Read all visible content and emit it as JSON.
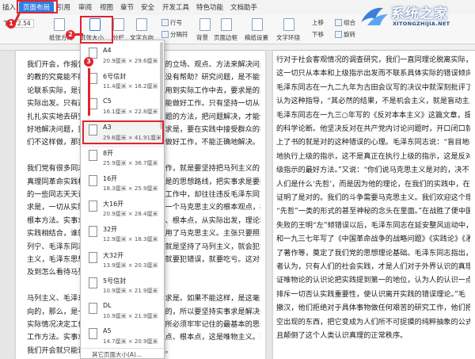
{
  "ribbon": {
    "tabs": [
      "插入",
      "页面布局",
      "引用",
      "审阅",
      "视图",
      "章节",
      "安全",
      "开发工具",
      "特色功能",
      "文档助手"
    ],
    "active_tab": "页面布局",
    "items": {
      "margins_label": "下:",
      "margin_value": "2.54",
      "paper_direction": "纸张方向",
      "paper_size": "纸张大小",
      "columns": "分栏",
      "text_direction": "文字方向",
      "line_numbers": "行号",
      "breaks": "分隔符",
      "background": "背景",
      "page_border": "页面边框",
      "manuscript": "稿纸设置",
      "wrap_text": "文字环绕",
      "combine": "组合",
      "rotate": "旋转",
      "up": "上移",
      "down": "下移"
    }
  },
  "watermark": {
    "title": "系统之家",
    "url": "XITONGZHIJIA.NET"
  },
  "dropdown": {
    "items": [
      {
        "name": "A4",
        "size": "20.9厘米 × 29.6厘米"
      },
      {
        "name": "6号信封",
        "size": "11.4厘米 × 16.2厘米"
      },
      {
        "name": "C5",
        "size": "16.1厘米 × 22.8厘米"
      },
      {
        "name": "A3",
        "size": "29.6厘米 × 41.91厘米"
      },
      {
        "name": "8开",
        "size": "25.9厘米 × 36.7厘米"
      },
      {
        "name": "16开",
        "size": "18.3厘米 × 25.9厘米"
      },
      {
        "name": "大16开",
        "size": "20.9厘米 × 28.4厘米"
      },
      {
        "name": "32开",
        "size": "12.9厘米 × 18.3厘米"
      },
      {
        "name": "大32开",
        "size": "13.9厘米 × 20.3厘米"
      },
      {
        "name": "5号信封",
        "size": "10.9厘米 × 21.9厘米"
      },
      {
        "name": "DL",
        "size": "10.9厘米 × 21.9厘米"
      },
      {
        "name": "A5",
        "size": "14.7厘米 × 20.9厘米"
      }
    ],
    "more": "其它页面大小(A)..."
  },
  "steps": [
    "1",
    "2",
    "3"
  ],
  "page_left": {
    "lines": [
      "我们开会，作报告，就必须运用马克思主义的立场、观点、方法来解决问题。",
      "的教的究竟能不能解决问题，对实际工作有没有帮助？研究问题，是不能够把理",
      "论联系实际，是否善于把马克思主义理论运用到实际工作中去，要求是的态度，一切从",
      "实际出发。只有这样，才能解决好问题，才能做好工作。只有坚持一切从实际出发，",
      "扎扎实实地去研究问题，才能够找到解决问题的方法，把问题解决，才能做好",
      "好地解决问题，我们究竟是不是要坚持实事求是，要在实践中接受群众的检验。如果我",
      "们不这样做，那我们就不能解决问题，不能做好工作，不能正确地解决。",
      "",
      "    我们党有很多同志都懂得，我们开展这项工作，就是要坚持把马列主义的普遍",
      "真理同革命实践相结合，就是要坚持实事求是的思想路线，把实事求是要继续发扬，",
      "的一些同志天天讲毛泽东思想，可是在实际工作中，却往往违反毛泽东同志的实事",
      "求是，一切从实际出发，理论联系实际这样一个马克思主义的根本观点，根本方法，",
      "根本方法。实事求是是毛泽东思想的出发点、根本点，从实际出发，理论和",
      "实践相结合，谁就是坚持实事求是，正确运用了马克思主义。主张只要照抄马克思、",
      "列宁、毛泽东同志的原话，照抄照转照搬，就是坚持了马列主义，就会犯错误。",
      "主义，毛泽东思想，违反实事求是的原则，就要犯错误，就要吃亏。这对于我们",
      "及到怎么看待马列主义，关系重大的问题。",
      "",
      "    马列主义、毛泽东思想的根本点，就是实事求是。如果不能这样，是这毫无疑",
      "向的，那么，是一定要和实际情况联系起来的，所以要坚持实事求是解决问题。按照",
      "实际情况决定工作方针，这是一切共产党员所必须牢牢记住的最基本的思想方法。",
      "工作方法。实事求是，是毛泽东思想的出发点、根本点，这是唯物主义。不然，",
      "我们开会就只能讲空话，不能解决任何问题。"
    ]
  },
  "page_right": {
    "lines": [
      "行对于社会客观情况的调查研究，我们一直同理论脱离实际，同实际问",
      "这一切只从本本和上级指示出发而不联系具体实际的错误倾向，早在",
      "毛泽东同志在一九二九年为古田会议写的决议中就深刻批评了这种",
      "认为这种指导，“其必然的结果，不是机会主义，就是盲动主义”。",
      "毛泽东同志在一九三○年写的《反对本本主义》这篇文章，提出“没有调查",
      "的科学论断。他坚决反对在共产党内讨论问题时，开口闭口就“拿本本来”，",
      "上了书的就是对的这种错误的心理。毛泽东同志说：“盲目地表面地",
      "地执行上级的指示，这不是真正在执行上级的指示，这是反对上级指示",
      "级指示的最好方法。”又说：“你们说马克思主义是对的，决不",
      "人们是什么‘先哲’，而是因为他的理论，在我们的实践中，在我们的",
      "证明了是对的。我们的斗争需要马克思主义。我们欢迎这个理论，这",
      "“先哲”一类的形式的甚至神秘的念头在里面。”在战胜了便中国共产",
      "失败的王明“左”倾错误以后，毛泽东同志在延安整风运动中，在",
      "和一九三七年写了《中国革命战争的战略问题》《实践论》《矛盾",
      "了著作等，奠定了我们党的思想理论基础。毛泽东同志指出，马克思",
      "者认为，只有人们的社会实践，才是人们对于外界认识的真理性的",
      "证唯物论的认识论把实践提到第一的地位，认为人的认识一点也不",
      "排斥一切否认实践重要性，使认识离开实践的错误理论。”毛",
      "撤汉，他们拒绝对于具体事物做任何艰苦的研究工作，他们把一般",
      "空出现的东西，把它变成为人们所不可捉摸的纯粹抽象的公式，完",
      "且颠倒了这个人类认识真理的正常秩序。"
    ]
  }
}
